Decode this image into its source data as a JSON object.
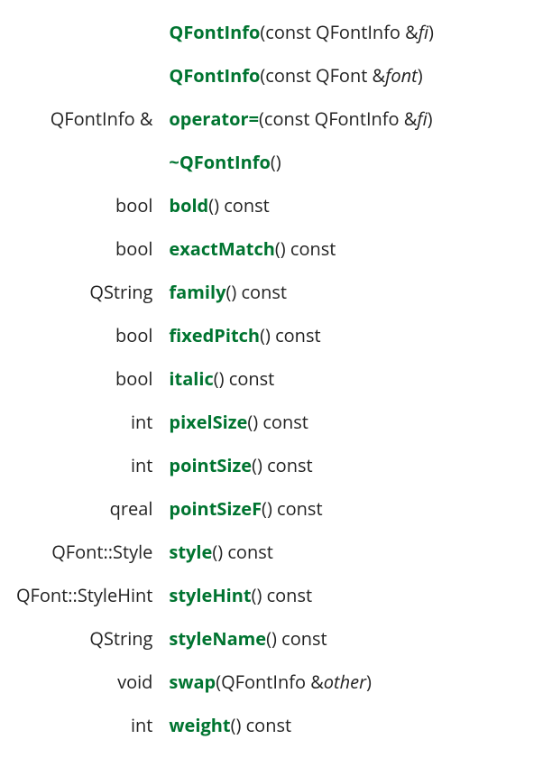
{
  "members": [
    {
      "return": "",
      "name": "QFontInfo",
      "open": "(const QFontInfo ",
      "amp": "&",
      "param": "fi",
      "close": ")",
      "suffix": ""
    },
    {
      "return": "",
      "name": "QFontInfo",
      "open": "(const QFont ",
      "amp": "&",
      "param": "font",
      "close": ")",
      "suffix": ""
    },
    {
      "return": "QFontInfo &",
      "name": "operator=",
      "open": "(const QFontInfo ",
      "amp": "&",
      "param": "fi",
      "close": ")",
      "suffix": ""
    },
    {
      "return": "",
      "name": "~QFontInfo",
      "open": "(",
      "amp": "",
      "param": "",
      "close": ")",
      "suffix": ""
    },
    {
      "return": "bool",
      "name": "bold",
      "open": "(",
      "amp": "",
      "param": "",
      "close": ")",
      "suffix": " const"
    },
    {
      "return": "bool",
      "name": "exactMatch",
      "open": "(",
      "amp": "",
      "param": "",
      "close": ")",
      "suffix": " const"
    },
    {
      "return": "QString",
      "name": "family",
      "open": "(",
      "amp": "",
      "param": "",
      "close": ")",
      "suffix": " const"
    },
    {
      "return": "bool",
      "name": "fixedPitch",
      "open": "(",
      "amp": "",
      "param": "",
      "close": ")",
      "suffix": " const"
    },
    {
      "return": "bool",
      "name": "italic",
      "open": "(",
      "amp": "",
      "param": "",
      "close": ")",
      "suffix": " const"
    },
    {
      "return": "int",
      "name": "pixelSize",
      "open": "(",
      "amp": "",
      "param": "",
      "close": ")",
      "suffix": " const"
    },
    {
      "return": "int",
      "name": "pointSize",
      "open": "(",
      "amp": "",
      "param": "",
      "close": ")",
      "suffix": " const"
    },
    {
      "return": "qreal",
      "name": "pointSizeF",
      "open": "(",
      "amp": "",
      "param": "",
      "close": ")",
      "suffix": " const"
    },
    {
      "return": "QFont::Style",
      "name": "style",
      "open": "(",
      "amp": "",
      "param": "",
      "close": ")",
      "suffix": " const"
    },
    {
      "return": "QFont::StyleHint",
      "name": "styleHint",
      "open": "(",
      "amp": "",
      "param": "",
      "close": ")",
      "suffix": " const"
    },
    {
      "return": "QString",
      "name": "styleName",
      "open": "(",
      "amp": "",
      "param": "",
      "close": ")",
      "suffix": " const"
    },
    {
      "return": "void",
      "name": "swap",
      "open": "(QFontInfo ",
      "amp": "&",
      "param": "other",
      "close": ")",
      "suffix": ""
    },
    {
      "return": "int",
      "name": "weight",
      "open": "(",
      "amp": "",
      "param": "",
      "close": ")",
      "suffix": " const"
    }
  ]
}
